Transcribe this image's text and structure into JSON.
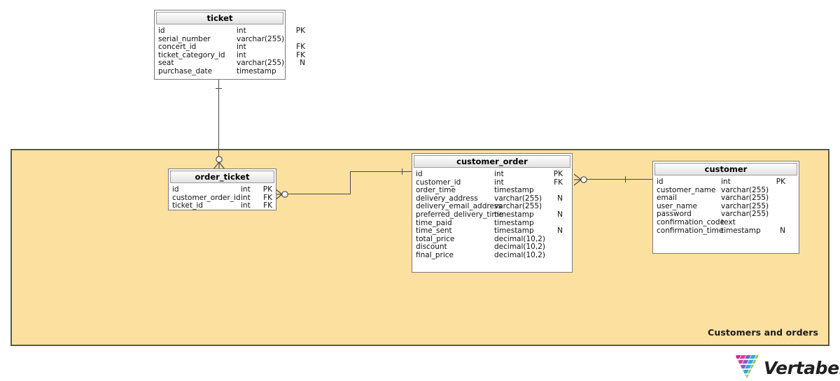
{
  "diagram": {
    "subject_area": {
      "label": "Customers and orders",
      "fill_color": "#fbe0a0",
      "border_color": "#585c44"
    },
    "canvas_background": "#ffffff"
  },
  "entities": {
    "ticket": {
      "name": "ticket",
      "columns": [
        {
          "name": "id",
          "type": "int",
          "key": "PK"
        },
        {
          "name": "serial_number",
          "type": "varchar(255)",
          "key": ""
        },
        {
          "name": "concert_id",
          "type": "int",
          "key": "FK"
        },
        {
          "name": "ticket_category_id",
          "type": "int",
          "key": "FK"
        },
        {
          "name": "seat",
          "type": "varchar(255)",
          "key": "N"
        },
        {
          "name": "purchase_date",
          "type": "timestamp",
          "key": ""
        }
      ]
    },
    "order_ticket": {
      "name": "order_ticket",
      "columns": [
        {
          "name": "id",
          "type": "int",
          "key": "PK"
        },
        {
          "name": "customer_order_id",
          "type": "int",
          "key": "FK"
        },
        {
          "name": "ticket_id",
          "type": "int",
          "key": "FK"
        }
      ]
    },
    "customer_order": {
      "name": "customer_order",
      "columns": [
        {
          "name": "id",
          "type": "int",
          "key": "PK"
        },
        {
          "name": "customer_id",
          "type": "int",
          "key": "FK"
        },
        {
          "name": "order_time",
          "type": "timestamp",
          "key": ""
        },
        {
          "name": "delivery_address",
          "type": "varchar(255)",
          "key": "N"
        },
        {
          "name": "delivery_email_address",
          "type": "varchar(255)",
          "key": ""
        },
        {
          "name": "preferred_delivery_time",
          "type": "timestamp",
          "key": "N"
        },
        {
          "name": "time_paid",
          "type": "timestamp",
          "key": ""
        },
        {
          "name": "time_sent",
          "type": "timestamp",
          "key": "N"
        },
        {
          "name": "total_price",
          "type": "decimal(10,2)",
          "key": ""
        },
        {
          "name": "discount",
          "type": "decimal(10,2)",
          "key": ""
        },
        {
          "name": "final_price",
          "type": "decimal(10,2)",
          "key": ""
        }
      ]
    },
    "customer": {
      "name": "customer",
      "columns": [
        {
          "name": "id",
          "type": "int",
          "key": "PK"
        },
        {
          "name": "customer_name",
          "type": "varchar(255)",
          "key": ""
        },
        {
          "name": "email",
          "type": "varchar(255)",
          "key": ""
        },
        {
          "name": "user_name",
          "type": "varchar(255)",
          "key": ""
        },
        {
          "name": "password",
          "type": "varchar(255)",
          "key": ""
        },
        {
          "name": "confirmation_code",
          "type": "text",
          "key": ""
        },
        {
          "name": "confirmation_time",
          "type": "timestamp",
          "key": "N"
        }
      ]
    }
  },
  "relationships": [
    {
      "name": "ticket-to-order_ticket",
      "from": "ticket",
      "to": "order_ticket",
      "from_cardinality": "one",
      "to_cardinality": "zero-or-many"
    },
    {
      "name": "order_ticket-to-customer_order",
      "from": "customer_order",
      "to": "order_ticket",
      "from_cardinality": "one",
      "to_cardinality": "zero-or-many"
    },
    {
      "name": "customer_order-to-customer",
      "from": "customer",
      "to": "customer_order",
      "from_cardinality": "one",
      "to_cardinality": "zero-or-many"
    }
  ],
  "branding": {
    "wordmark": "Vertabelo",
    "logo_colors": [
      "#c2358a",
      "#e0399a",
      "#7b5fc0",
      "#2aa9e0",
      "#8dc63f"
    ]
  }
}
